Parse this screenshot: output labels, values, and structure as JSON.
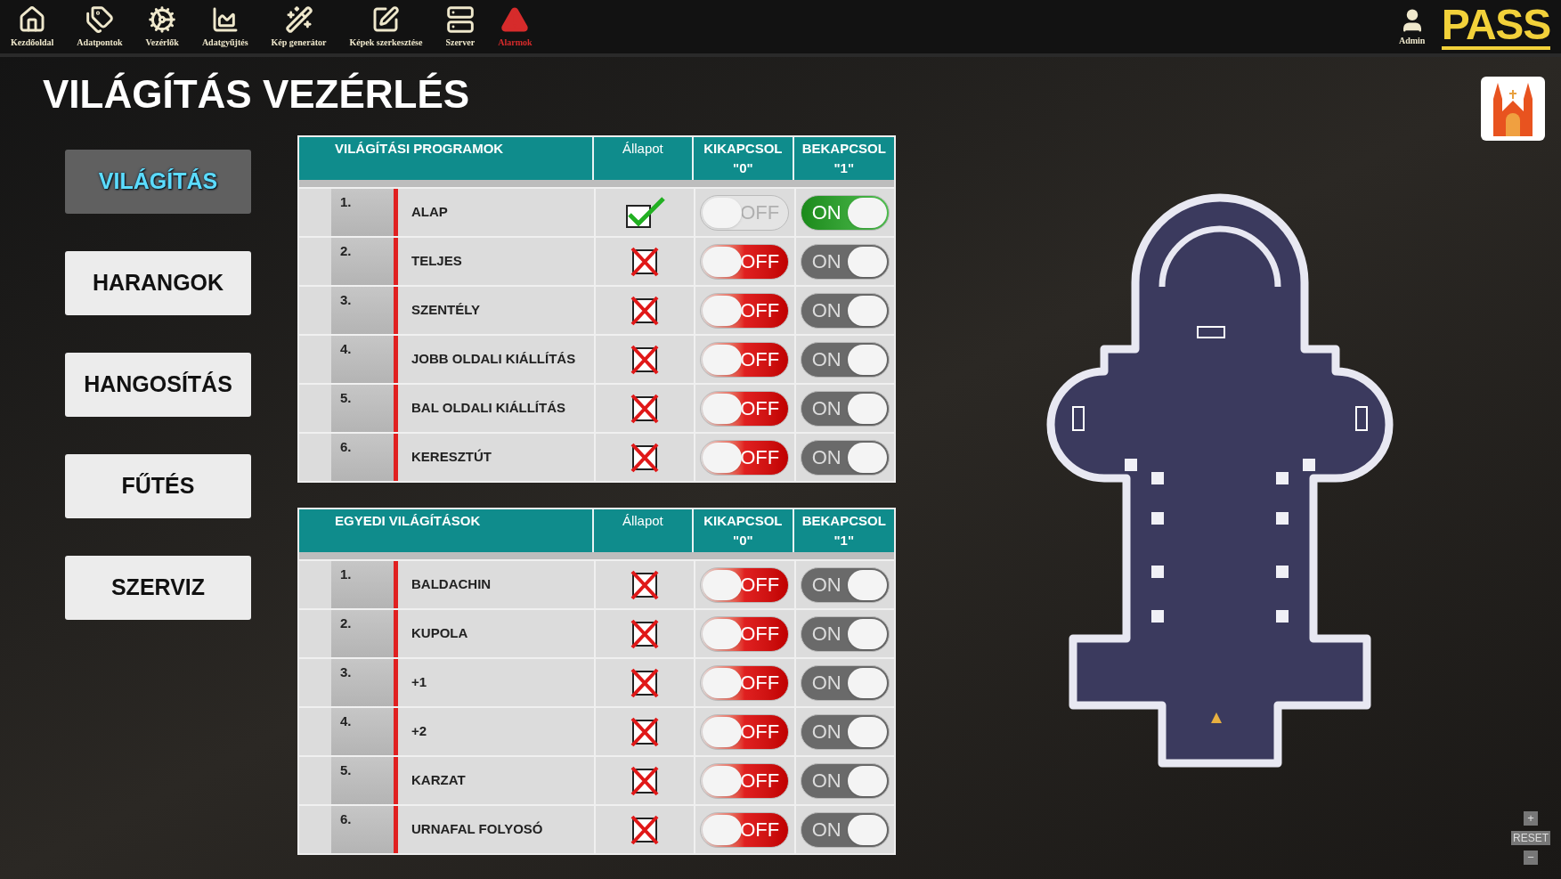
{
  "nav": [
    {
      "label": "Kezdőoldal",
      "alert": false
    },
    {
      "label": "Adatpontok",
      "alert": false
    },
    {
      "label": "Vezérlők",
      "alert": false
    },
    {
      "label": "Adatgyűjtés",
      "alert": false
    },
    {
      "label": "Kép generátor",
      "alert": false
    },
    {
      "label": "Képek szerkesztése",
      "alert": false
    },
    {
      "label": "Szerver",
      "alert": false
    },
    {
      "label": "Alarmok",
      "alert": true
    }
  ],
  "user": {
    "label": "Admin"
  },
  "logo": "PASS",
  "page_title": "VILÁGÍTÁS VEZÉRLÉS",
  "menu": [
    {
      "label": "VILÁGÍTÁS",
      "selected": true
    },
    {
      "label": "HARANGOK",
      "selected": false
    },
    {
      "label": "HANGOSÍTÁS",
      "selected": false
    },
    {
      "label": "FŰTÉS",
      "selected": false
    },
    {
      "label": "SZERVIZ",
      "selected": false
    }
  ],
  "tables": [
    {
      "columns": [
        "VILÁGÍTÁSI PROGRAMOK",
        "Állapot",
        "KIKAPCSOL\n\"0\"",
        "BEKAPCSOL\n\"1\""
      ],
      "rows": [
        {
          "number": "1.",
          "name": "ALAP",
          "on": true,
          "off_switch": "OFF",
          "on_switch": "ON"
        },
        {
          "number": "2.",
          "name": "TELJES",
          "on": false,
          "off_switch": "OFF",
          "on_switch": "ON"
        },
        {
          "number": "3.",
          "name": "SZENTÉLY",
          "on": false,
          "off_switch": "OFF",
          "on_switch": "ON"
        },
        {
          "number": "4.",
          "name": "JOBB OLDALI KIÁLLÍTÁS",
          "on": false,
          "off_switch": "OFF",
          "on_switch": "ON"
        },
        {
          "number": "5.",
          "name": "BAL OLDALI KIÁLLÍTÁS",
          "on": false,
          "off_switch": "OFF",
          "on_switch": "ON"
        },
        {
          "number": "6.",
          "name": "KERESZTÚT",
          "on": false,
          "off_switch": "OFF",
          "on_switch": "ON"
        }
      ]
    },
    {
      "columns": [
        "EGYEDI VILÁGÍTÁSOK",
        "Állapot",
        "KIKAPCSOL\n\"0\"",
        "BEKAPCSOL\n\"1\""
      ],
      "rows": [
        {
          "number": "1.",
          "name": "BALDACHIN",
          "on": false,
          "off_switch": "OFF",
          "on_switch": "ON"
        },
        {
          "number": "2.",
          "name": "KUPOLA",
          "on": false,
          "off_switch": "OFF",
          "on_switch": "ON"
        },
        {
          "number": "3.",
          "name": "+1",
          "on": false,
          "off_switch": "OFF",
          "on_switch": "ON"
        },
        {
          "number": "4.",
          "name": "+2",
          "on": false,
          "off_switch": "OFF",
          "on_switch": "ON"
        },
        {
          "number": "5.",
          "name": "KARZAT",
          "on": false,
          "off_switch": "OFF",
          "on_switch": "ON"
        },
        {
          "number": "6.",
          "name": "URNAFAL FOLYOSÓ",
          "on": false,
          "off_switch": "OFF",
          "on_switch": "ON"
        }
      ]
    }
  ],
  "zoom_controls": {
    "zoom_in": "+",
    "reset": "RESET",
    "zoom_out": "−"
  }
}
